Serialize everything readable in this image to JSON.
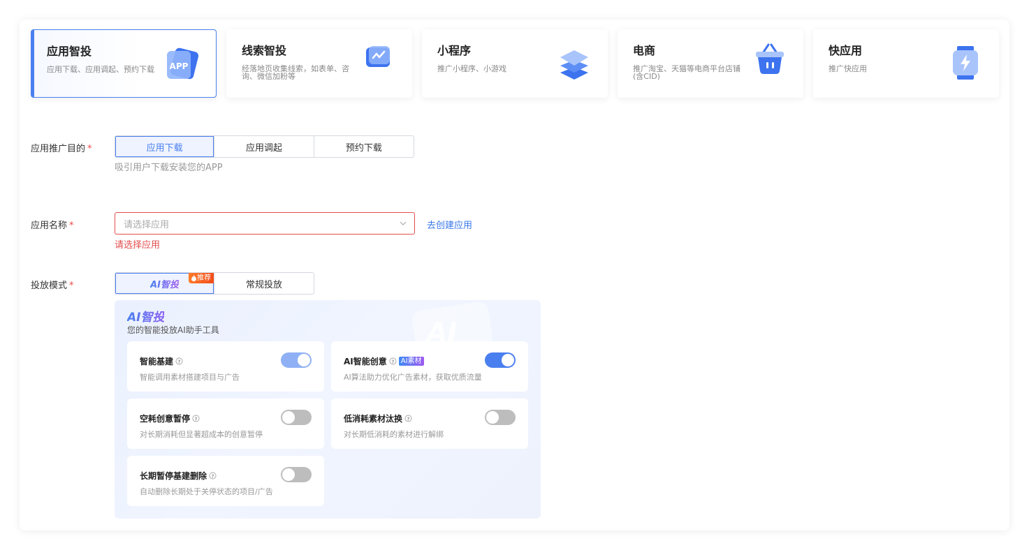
{
  "types": [
    {
      "title": "应用智投",
      "desc": "应用下载、应用调起、预约下载",
      "icon": "app-store-icon",
      "active": true
    },
    {
      "title": "线索智投",
      "desc": "经落地页收集线索，如表单、咨询、微信加粉等",
      "icon": "chart-card-icon"
    },
    {
      "title": "小程序",
      "desc": "推广小程序、小游戏",
      "icon": "layers-icon"
    },
    {
      "title": "电商",
      "desc": "推广淘宝、天猫等电商平台店铺(含CID)",
      "icon": "shopping-basket-icon"
    },
    {
      "title": "快应用",
      "desc": "推广快应用",
      "icon": "lightning-watch-icon"
    }
  ],
  "purpose": {
    "label": "应用推广目的",
    "required": "*",
    "options": [
      "应用下载",
      "应用调起",
      "预约下载"
    ],
    "selected": "应用下载",
    "hint": "吸引用户下载安装您的APP"
  },
  "app_name": {
    "label": "应用名称",
    "required": "*",
    "placeholder": "请选择应用",
    "link": "去创建应用",
    "error": "请选择应用"
  },
  "mode": {
    "label": "投放模式",
    "required": "*",
    "ai_option": "AI智投",
    "badge": "推荐",
    "normal_option": "常规投放"
  },
  "ai_panel": {
    "title": "AI智投",
    "subtitle": "您的智能投放AI助手工具",
    "deco": "AI",
    "features": [
      {
        "title": "智能基建",
        "desc": "智能调用素材搭建项目与广告",
        "enabled": true
      },
      {
        "title": "AI智能创意",
        "tag": "AI素材",
        "desc": "AI算法助力优化广告素材，获取优质流量",
        "enabled": true
      },
      {
        "title": "空耗创意暂停",
        "desc": "对长期消耗但显著超成本的创意暂停",
        "enabled": false
      },
      {
        "title": "低消耗素材汰换",
        "desc": "对长期低消耗的素材进行解绑",
        "enabled": false
      },
      {
        "title": "长期暂停基建删除",
        "desc": "自动删除长期处于关停状态的项目/广告",
        "enabled": false
      }
    ]
  },
  "colors": {
    "accent": "#4a7ff0",
    "error": "#e34d4d",
    "link": "#3a78e8"
  }
}
